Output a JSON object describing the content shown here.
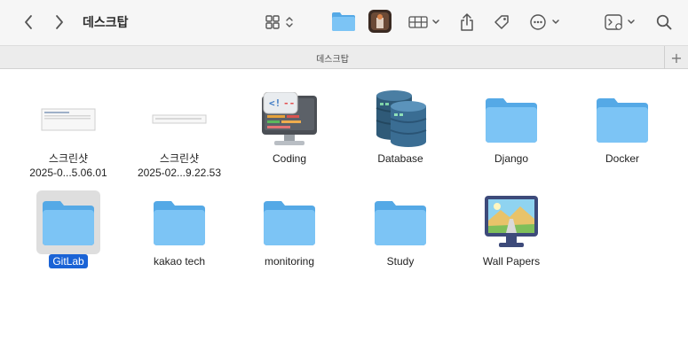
{
  "window": {
    "title": "데스크탑",
    "tab_label": "데스크탑",
    "tab_add": "+"
  },
  "toolbar": {
    "back_icon": "chevron-left-icon",
    "forward_icon": "chevron-right-icon",
    "view_icon": "grid-view-icon",
    "group_icon": "group-grid-icon",
    "share_icon": "share-icon",
    "tag_icon": "tag-icon",
    "more_icon": "ellipsis-circle-icon",
    "terminal_icon": "terminal-icon",
    "search_icon": "search-icon"
  },
  "items": [
    {
      "label": "스크린샷",
      "sublabel": "2025-0...5.06.01",
      "icon": "screenshot-thumbnail"
    },
    {
      "label": "스크린샷",
      "sublabel": "2025-02...9.22.53",
      "icon": "screenshot-thumbnail"
    },
    {
      "label": "Coding",
      "icon": "coding-monitor-icon"
    },
    {
      "label": "Database",
      "icon": "database-icon"
    },
    {
      "label": "Django",
      "icon": "folder-icon"
    },
    {
      "label": "Docker",
      "icon": "folder-icon"
    },
    {
      "label": "GitLab",
      "icon": "folder-icon",
      "selected": true
    },
    {
      "label": "kakao tech",
      "icon": "folder-icon"
    },
    {
      "label": "monitoring",
      "icon": "folder-icon"
    },
    {
      "label": "Study",
      "icon": "folder-icon"
    },
    {
      "label": "Wall Papers",
      "icon": "wallpaper-monitor-icon"
    }
  ],
  "colors": {
    "folder_light": "#7cc4f5",
    "folder_dark": "#55a9e6",
    "selection": "#1a63d6"
  }
}
